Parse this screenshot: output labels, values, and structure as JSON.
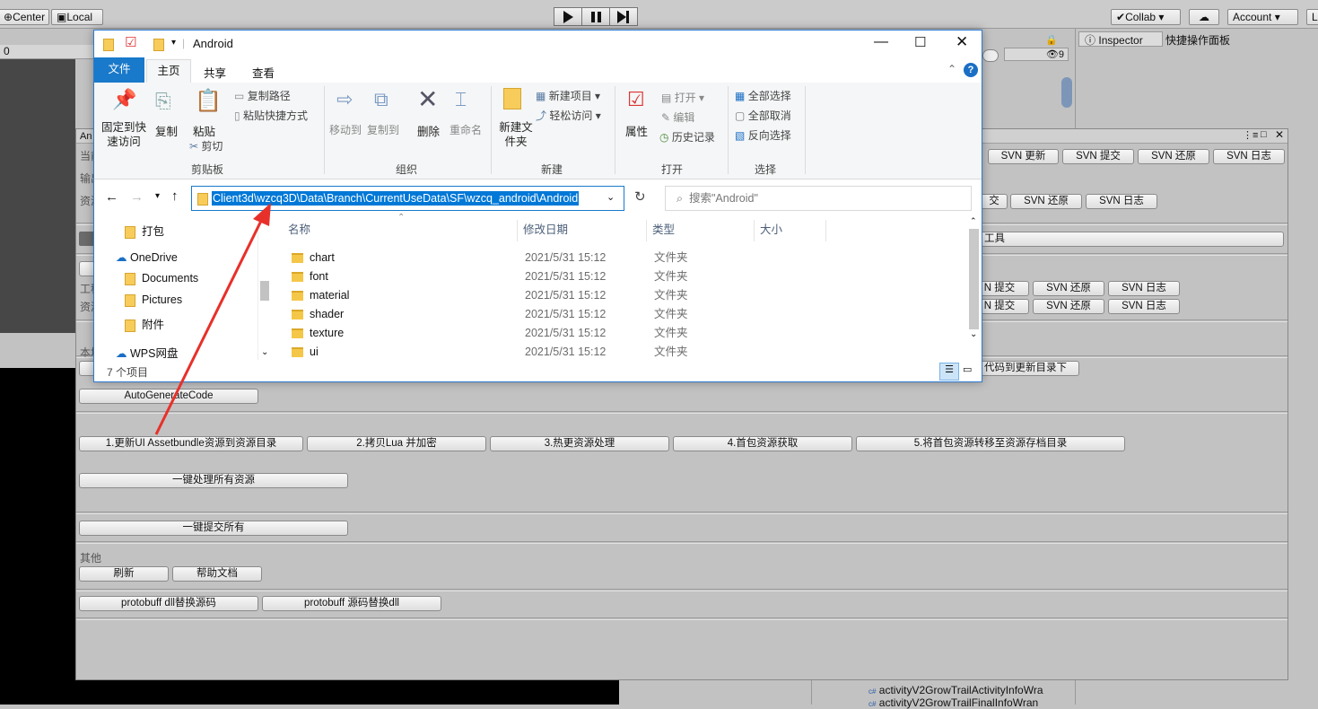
{
  "unity": {
    "pivot": "Center",
    "space": "Local",
    "collab": "Collab ▾",
    "account": "Account",
    "layers": "L",
    "search_count": "0",
    "inspector_tab": "Inspector",
    "quick_panel_tab": "快捷操作面板",
    "hidden_count": "9",
    "project_files": [
      "activityV2GrowTrailActivityInfoWra",
      "activityV2GrowTrailFinalInfoWran"
    ]
  },
  "tool": {
    "title": "An",
    "left_labels": [
      "当前",
      "输出",
      "资源",
      "工程",
      "资源",
      "本地"
    ],
    "svn_row1": [
      "SVN 更新",
      "SVN 提交",
      "SVN 还原",
      "SVN 日志"
    ],
    "svn_row2": [
      "交",
      "SVN 还原",
      "SVN 日志"
    ],
    "tools_btn": "工具",
    "svn_row3": [
      "N 提交",
      "SVN 还原",
      "SVN 日志"
    ],
    "svn_row4": [
      "N 提交",
      "SVN 还原",
      "SVN 日志"
    ],
    "copy_code_btn": "代码到更新目录下",
    "auto_gen": "AutoGenerateCode",
    "steps": [
      "1.更新UI Assetbundle资源到资源目录",
      "2.拷贝Lua 并加密",
      "3.热更资源处理",
      "4.首包资源获取",
      "5.将首包资源转移至资源存档目录"
    ],
    "process_all": "一键处理所有资源",
    "commit_all": "一键提交所有",
    "other_label": "其他",
    "refresh": "刷新",
    "help": "帮助文档",
    "proto1": "protobuff dll替换源码",
    "proto2": "protobuff 源码替换dll"
  },
  "explorer": {
    "title": "Android",
    "tabs": [
      "文件",
      "主页",
      "共享",
      "查看"
    ],
    "ribbon": {
      "pin": "固定到快速访问",
      "copy": "复制",
      "paste": "粘贴",
      "copy_path": "复制路径",
      "paste_shortcut": "粘贴快捷方式",
      "cut": "剪切",
      "move_to": "移动到",
      "copy_to": "复制到",
      "delete": "删除",
      "rename": "重命名",
      "new_folder": "新建文件夹",
      "new_item": "新建项目 ▾",
      "easy_access": "轻松访问 ▾",
      "properties": "属性",
      "open": "打开 ▾",
      "edit": "编辑",
      "history": "历史记录",
      "select_all": "全部选择",
      "select_none": "全部取消",
      "invert": "反向选择",
      "groups": [
        "剪贴板",
        "组织",
        "新建",
        "打开",
        "选择"
      ]
    },
    "address": "Client3d\\wzcq3D\\Data\\Branch\\CurrentUseData\\SF\\wzcq_android\\Android",
    "search_placeholder": "搜索\"Android\"",
    "nav": [
      "打包",
      "OneDrive",
      "Documents",
      "Pictures",
      "附件",
      "WPS网盘"
    ],
    "columns": [
      "名称",
      "修改日期",
      "类型",
      "大小"
    ],
    "files": [
      {
        "name": "chart",
        "date": "2021/5/31 15:12",
        "type": "文件夹"
      },
      {
        "name": "font",
        "date": "2021/5/31 15:12",
        "type": "文件夹"
      },
      {
        "name": "material",
        "date": "2021/5/31 15:12",
        "type": "文件夹"
      },
      {
        "name": "shader",
        "date": "2021/5/31 15:12",
        "type": "文件夹"
      },
      {
        "name": "texture",
        "date": "2021/5/31 15:12",
        "type": "文件夹"
      },
      {
        "name": "ui",
        "date": "2021/5/31 15:12",
        "type": "文件夹"
      }
    ],
    "status": "7 个项目"
  },
  "colors": {
    "accent": "#1a6fc4",
    "arrow": "#e8302a",
    "selection": "#0078d7"
  }
}
